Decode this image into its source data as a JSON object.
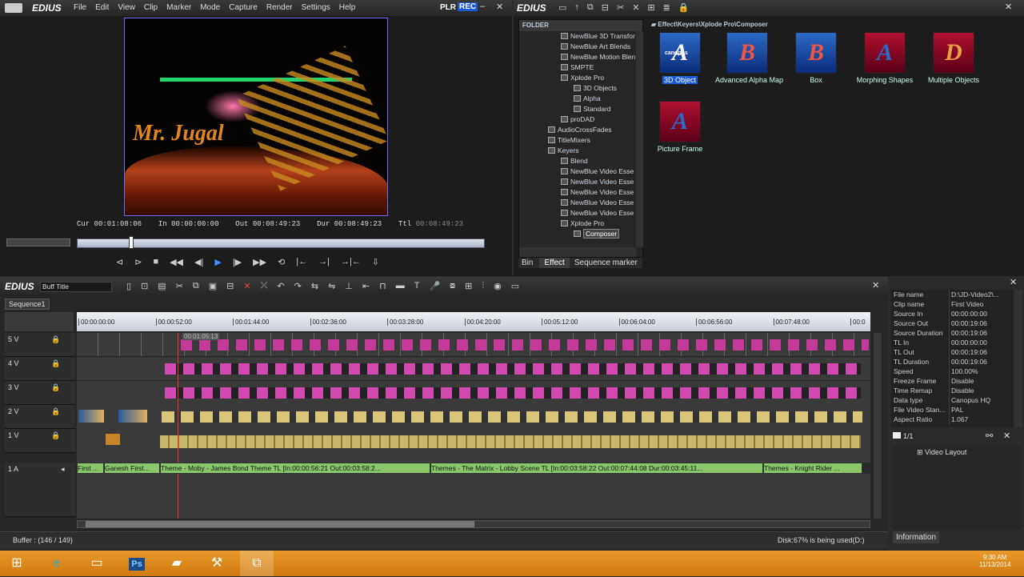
{
  "player": {
    "logo": "EDIUS",
    "menu": [
      "File",
      "Edit",
      "View",
      "Clip",
      "Marker",
      "Mode",
      "Capture",
      "Render",
      "Settings",
      "Help"
    ],
    "plr": "PLR",
    "rec": "REC",
    "cur_label": "Cur",
    "cur_value": "00:01:08:06",
    "in_label": "In",
    "in_value": "00:00:00:00",
    "out_label": "Out",
    "out_value": "00:08:49:23",
    "dur_label": "Dur",
    "dur_value": "00:08:49:23",
    "ttl_label": "Ttl",
    "ttl_value": "00:08:49:23",
    "preview_text": "Mr. Jugal"
  },
  "bin": {
    "logo": "EDIUS",
    "folder_label": "FOLDER",
    "path": "Effect\\Keyers\\Xplode Pro\\Composer",
    "tree": [
      "NewBlue 3D Transfor",
      "NewBlue Art Blends",
      "NewBlue Motion Blen",
      "SMPTE",
      "Xplode Pro",
      "3D Objects",
      "Alpha",
      "Standard",
      "proDAD",
      "AudioCrossFades",
      "TitleMixers",
      "Keyers",
      "Blend",
      "NewBlue Video Esse",
      "NewBlue Video Esse",
      "NewBlue Video Esse",
      "NewBlue Video Esse",
      "NewBlue Video Esse",
      "Xplode Pro",
      "Composer"
    ],
    "effects": [
      {
        "label": "3D Object",
        "glyph": "A",
        "badge": "canopus",
        "color": "blue"
      },
      {
        "label": "Advanced Alpha Map",
        "glyph": "B",
        "color": "blue"
      },
      {
        "label": "Box",
        "glyph": "B",
        "color": "blue"
      },
      {
        "label": "Morphing Shapes",
        "glyph": "A",
        "color": "red"
      },
      {
        "label": "Multiple Objects",
        "glyph": "D",
        "color": "red"
      },
      {
        "label": "Picture Frame",
        "glyph": "A",
        "color": "red"
      }
    ],
    "tabs": [
      "Bin",
      "Effect",
      "Sequence marker"
    ]
  },
  "timeline": {
    "logo": "EDIUS",
    "project": "Buff Title",
    "sequence_tab": "Sequence1",
    "ruler": [
      "00:00:00:00",
      "00:00:52:00",
      "00:01:44:00",
      "00:02:36:00",
      "00:03:28:00",
      "00:04:20:00",
      "00:05:12:00",
      "00:06:04:00",
      "00:06:56:00",
      "00:07:48:00",
      "00:0"
    ],
    "hover_tc": "00:01:05:13",
    "tracks": [
      "5 V",
      "4 V",
      "3 V",
      "2 V",
      "1 V",
      "1 A"
    ],
    "audio_clips": [
      "First ...",
      "Ganesh First...",
      "Theme - Moby - James Bond Theme  TL [In:00:00:56:21 Out:00:03:58:2...",
      "Themes - The Matrix - Lobby Scene  TL [In:00:03:58:22 Out:00:07:44:08 Dur:00:03:45:11...",
      "Themes - Knight Rider ..."
    ],
    "buffer": "Buffer : (146 / 149)",
    "disk": "Disk:67% is being used(D:)"
  },
  "info": {
    "rows": [
      {
        "k": "File name",
        "v": "D:\\JD-Video2\\..."
      },
      {
        "k": "Clip name",
        "v": "First Video"
      },
      {
        "k": "Source In",
        "v": "00:00:00:00"
      },
      {
        "k": "Source Out",
        "v": "00:00:19:06"
      },
      {
        "k": "Source Duration",
        "v": "00:00:19:06"
      },
      {
        "k": "TL In",
        "v": "00:00:00:00"
      },
      {
        "k": "TL Out",
        "v": "00:00:19:06"
      },
      {
        "k": "TL Duration",
        "v": "00:00:19:06"
      },
      {
        "k": "Speed",
        "v": "100.00%"
      },
      {
        "k": "Freeze Frame",
        "v": "Disable"
      },
      {
        "k": "Time Remap",
        "v": "Disable"
      },
      {
        "k": "Data type",
        "v": "Canopus HQ"
      },
      {
        "k": "File Video Stan...",
        "v": "PAL"
      },
      {
        "k": "Aspect Ratio",
        "v": "1.067"
      }
    ],
    "page": "1/1",
    "layout_item": "Video Layout",
    "tab": "Information"
  },
  "taskbar": {
    "time": "9:30 AM",
    "date": "11/13/2014",
    "ps_label": "Ps"
  }
}
